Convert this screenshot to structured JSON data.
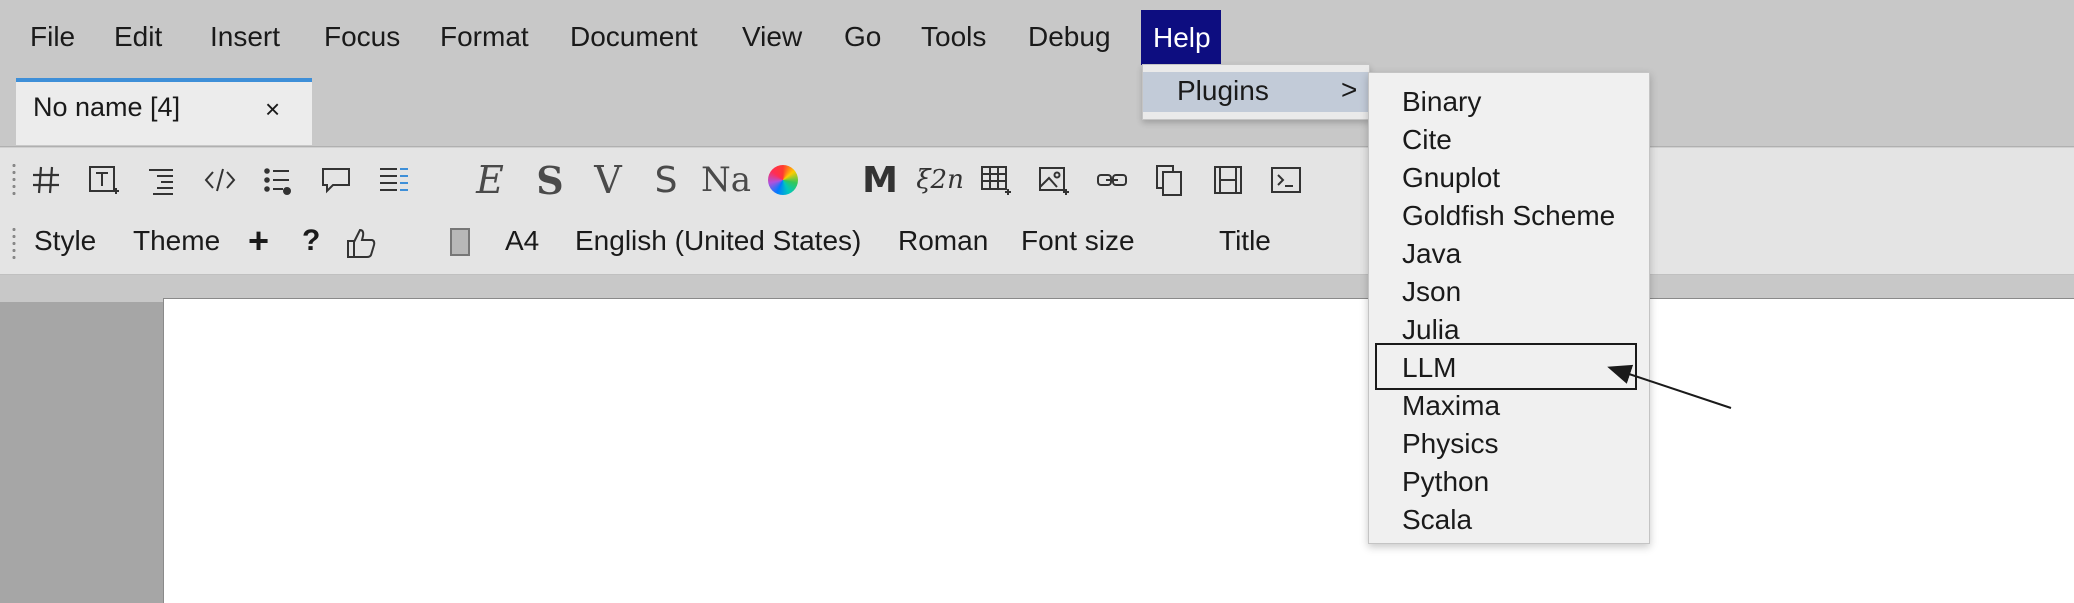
{
  "menubar": {
    "items": [
      "File",
      "Edit",
      "Insert",
      "Focus",
      "Format",
      "Document",
      "View",
      "Go",
      "Tools",
      "Debug",
      "Help"
    ],
    "active": "Help"
  },
  "tab": {
    "title": "No name [4]",
    "close": "×"
  },
  "iconbar": {
    "icons": [
      "hash-icon",
      "text-box-icon",
      "align-icon",
      "code-icon",
      "list-icon",
      "comment-icon",
      "table-align-icon",
      "euler-e-icon",
      "bold-s-icon",
      "v-icon",
      "s-icon",
      "na-icon",
      "color-wheel-icon",
      "m-icon",
      "xi-power-icon",
      "table-insert-icon",
      "image-insert-icon",
      "link-icon",
      "copy-icon",
      "film-icon",
      "terminal-icon"
    ],
    "glyphs": {
      "e": "E",
      "s1": "S",
      "v": "V",
      "s2": "S",
      "na": "Na",
      "m": "M",
      "xi": "ξ2n"
    }
  },
  "formatbar": {
    "style": "Style",
    "theme": "Theme",
    "plus": "+",
    "question": "?",
    "paper": "A4",
    "language": "English (United States)",
    "font": "Roman",
    "font_size": "Font size",
    "title": "Title"
  },
  "help_menu": {
    "plugins_label": "Plugins",
    "plugins_arrow": ">"
  },
  "plugins_submenu": {
    "items": [
      "Binary",
      "Cite",
      "Gnuplot",
      "Goldfish Scheme",
      "Java",
      "Json",
      "Julia",
      "LLM",
      "Maxima",
      "Physics",
      "Python",
      "Scala"
    ],
    "highlighted": "LLM"
  },
  "colors": {
    "menu_active_bg": "#0d0d80",
    "tab_accent": "#3e8fd8",
    "plugins_hover": "#c2cbd8"
  }
}
